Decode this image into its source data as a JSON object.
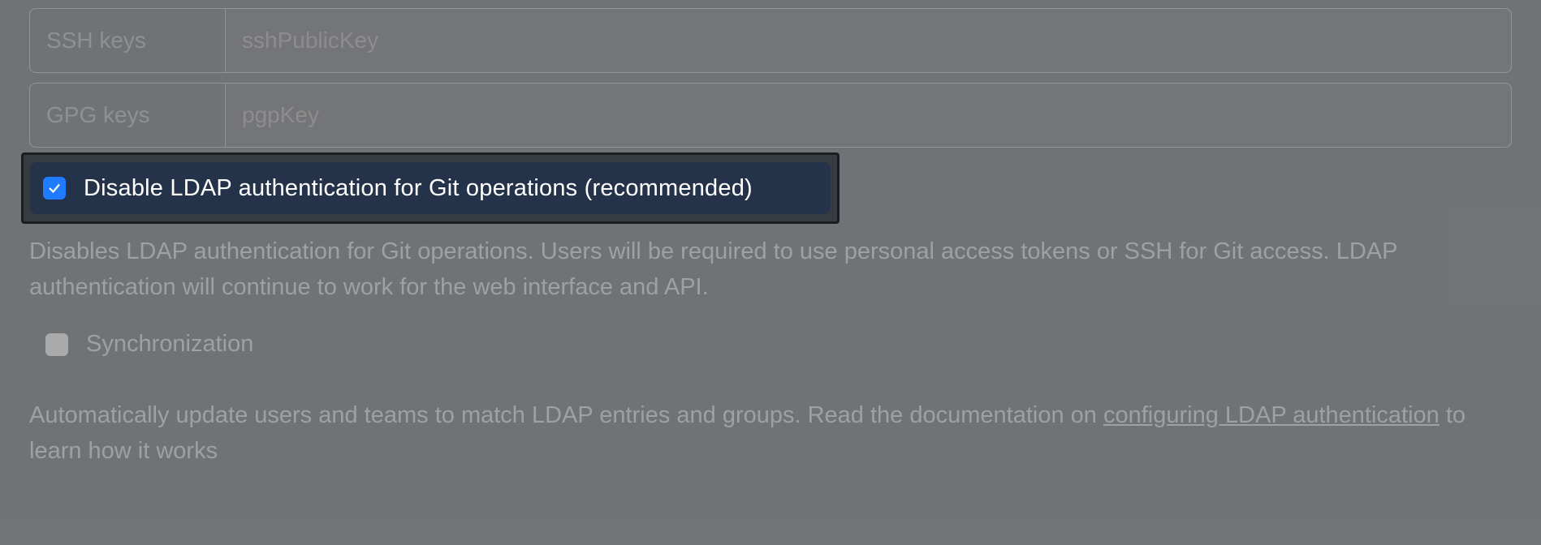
{
  "fields": {
    "ssh": {
      "label": "SSH keys",
      "placeholder": "sshPublicKey",
      "value": ""
    },
    "gpg": {
      "label": "GPG keys",
      "placeholder": "pgpKey",
      "value": ""
    }
  },
  "disable_ldap": {
    "checked": true,
    "label": "Disable LDAP authentication for Git operations (recommended)",
    "description": "Disables LDAP authentication for Git operations. Users will be required to use personal access tokens or SSH for Git access. LDAP authentication will continue to work for the web interface and API."
  },
  "synchronization": {
    "checked": false,
    "label": "Synchronization",
    "description_before_link": "Automatically update users and teams to match LDAP entries and groups. Read the documentation on ",
    "link_text": "configuring LDAP authentication",
    "description_after_link": " to learn how it works"
  }
}
